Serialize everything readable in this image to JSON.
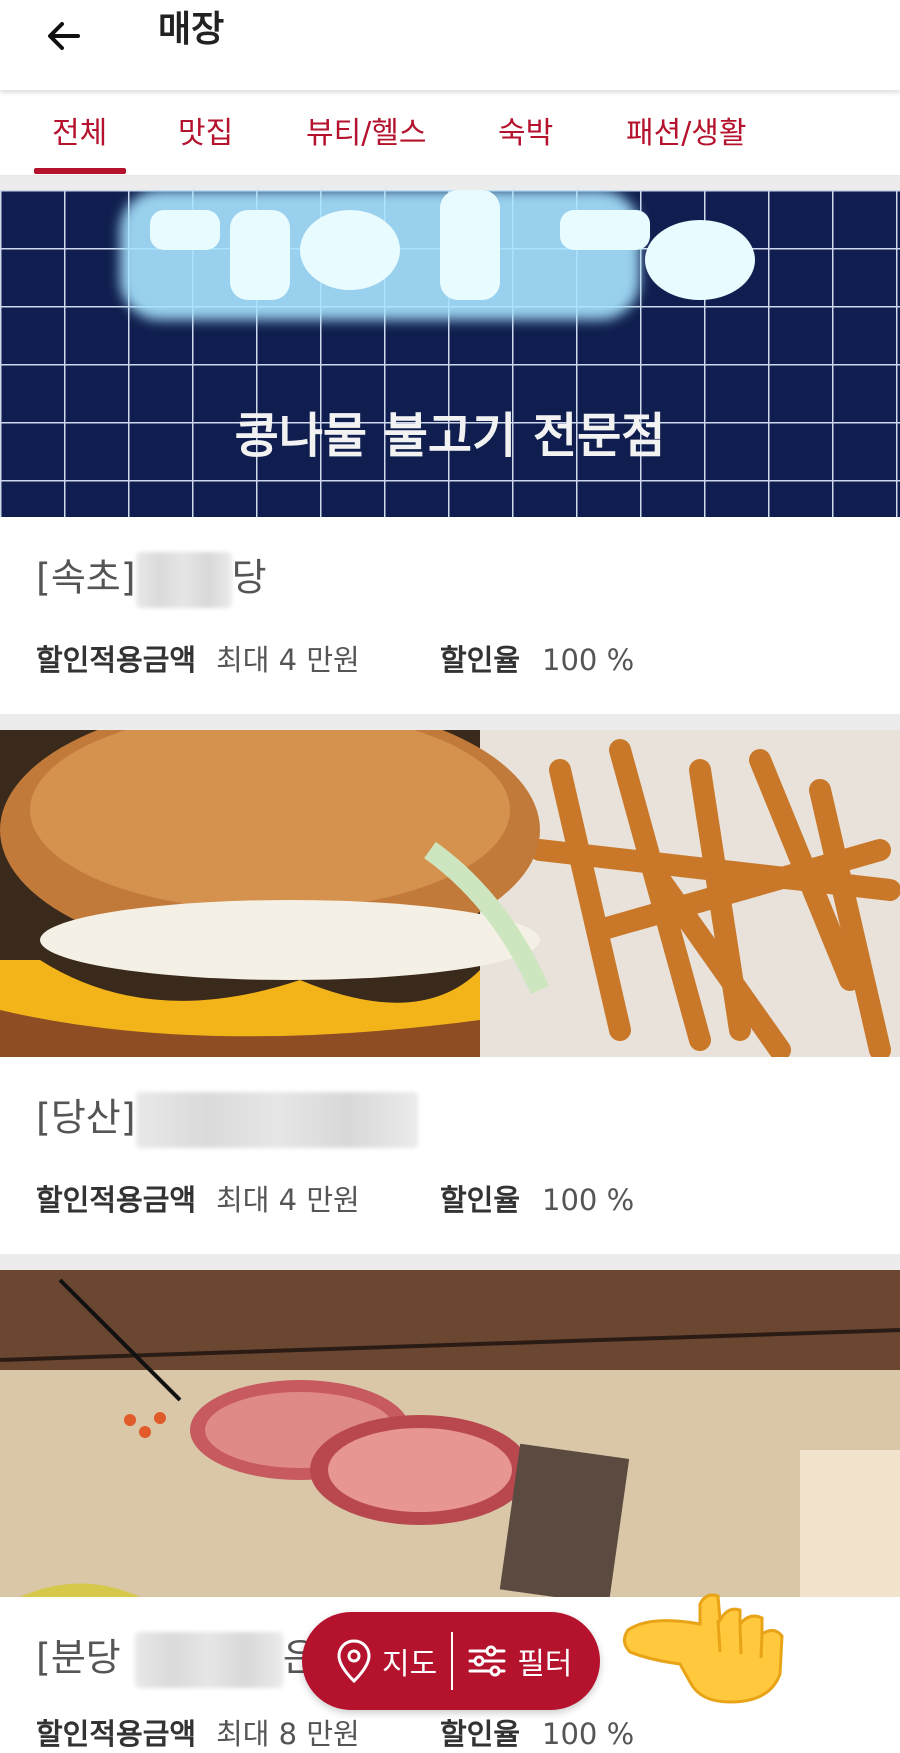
{
  "header": {
    "title": "매장"
  },
  "tabs": [
    {
      "label": "전체",
      "active": true
    },
    {
      "label": "맛집"
    },
    {
      "label": "뷰티/헬스"
    },
    {
      "label": "숙박"
    },
    {
      "label": "패션/생활"
    }
  ],
  "cards": [
    {
      "title_prefix": "[속초]",
      "title_suffix": "당",
      "image_sign_text": "콩나물 불고기 전문점",
      "discount_label": "할인적용금액",
      "discount_value": "최대 4 만원",
      "rate_label": "할인율",
      "rate_value": "100 %"
    },
    {
      "title_prefix": "[당산]",
      "title_suffix": "",
      "discount_label": "할인적용금액",
      "discount_value": "최대 4 만원",
      "rate_label": "할인율",
      "rate_value": "100 %"
    },
    {
      "title_prefix": "[분당",
      "title_suffix": "은",
      "discount_label": "할인적용금액",
      "discount_value": "최대 8 만원",
      "rate_label": "할인율",
      "rate_value": "100 %"
    }
  ],
  "fab": {
    "map_label": "지도",
    "filter_label": "필터"
  },
  "colors": {
    "accent": "#b5122d"
  }
}
